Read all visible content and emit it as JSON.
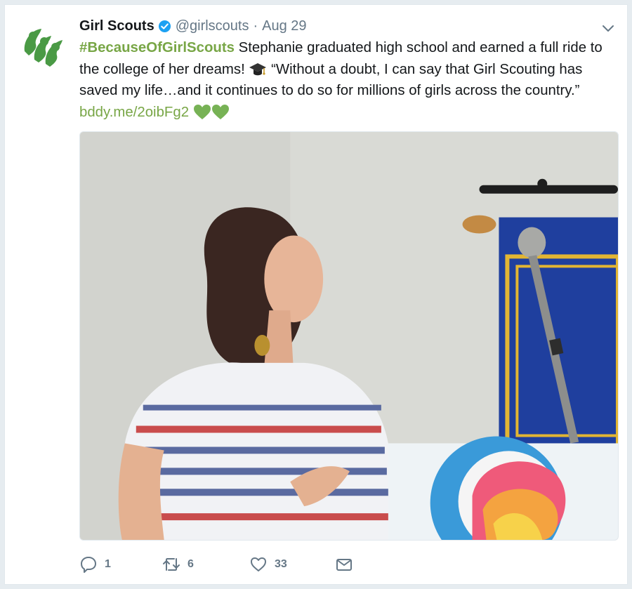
{
  "tweet": {
    "author_name": "Girl Scouts",
    "handle": "@girlscouts",
    "separator": "·",
    "date": "Aug 29",
    "hashtag": "#BecauseOfGirlScouts",
    "text_part1": " Stephanie graduated high school and earned a full ride to the college of her dreams! ",
    "text_part2": " “Without a doubt, I can say that Girl Scouting has saved my life…and it continues to do so for millions of girls across the country.” ",
    "link": "bddy.me/2oibFg2"
  },
  "actions": {
    "replies": "1",
    "retweets": "6",
    "likes": "33"
  },
  "colors": {
    "brand_green": "#78a646",
    "verified_blue": "#1da1f2",
    "muted": "#657786"
  },
  "icons": [
    "girl-scouts-logo-icon",
    "verified-badge-icon",
    "chevron-down-icon",
    "graduation-cap-icon",
    "green-heart-icon",
    "reply-icon",
    "retweet-icon",
    "like-icon",
    "direct-message-icon"
  ]
}
